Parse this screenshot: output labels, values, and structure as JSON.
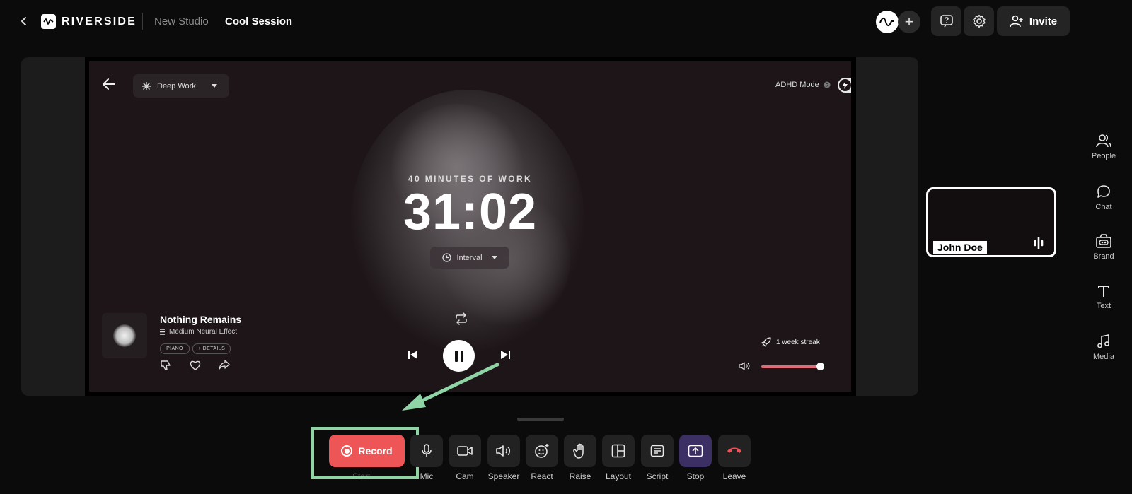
{
  "header": {
    "brand": "RIVERSIDE",
    "studio": "New Studio",
    "session": "Cool Session",
    "invite_label": "Invite",
    "plus": "+"
  },
  "screen": {
    "mode_label": "Deep Work",
    "adhd_label": "ADHD Mode",
    "work_label": "40 MINUTES OF WORK",
    "timer": "31:02",
    "interval_label": "Interval",
    "track_title": "Nothing Remains",
    "track_effect": "Medium Neural Effect",
    "tags": [
      "PIANO",
      "+ DETAILS"
    ],
    "streak": "1 week streak",
    "volume": 0.95
  },
  "participant": {
    "name": "John Doe"
  },
  "rail": [
    {
      "label": "People",
      "icon": "people-icon"
    },
    {
      "label": "Chat",
      "icon": "chat-icon"
    },
    {
      "label": "Brand",
      "icon": "brand-icon"
    },
    {
      "label": "Text",
      "icon": "text-icon"
    },
    {
      "label": "Media",
      "icon": "media-icon"
    }
  ],
  "controls": {
    "record_label": "Record",
    "start_label": "Start",
    "items": [
      "Mic",
      "Cam",
      "Speaker",
      "React",
      "Raise",
      "Layout",
      "Script",
      "Stop",
      "Leave"
    ]
  },
  "colors": {
    "record": "#ee5556",
    "highlight": "#8fd4a5",
    "stop_bg": "#3b2f63",
    "leave_icon": "#ef4f55"
  }
}
